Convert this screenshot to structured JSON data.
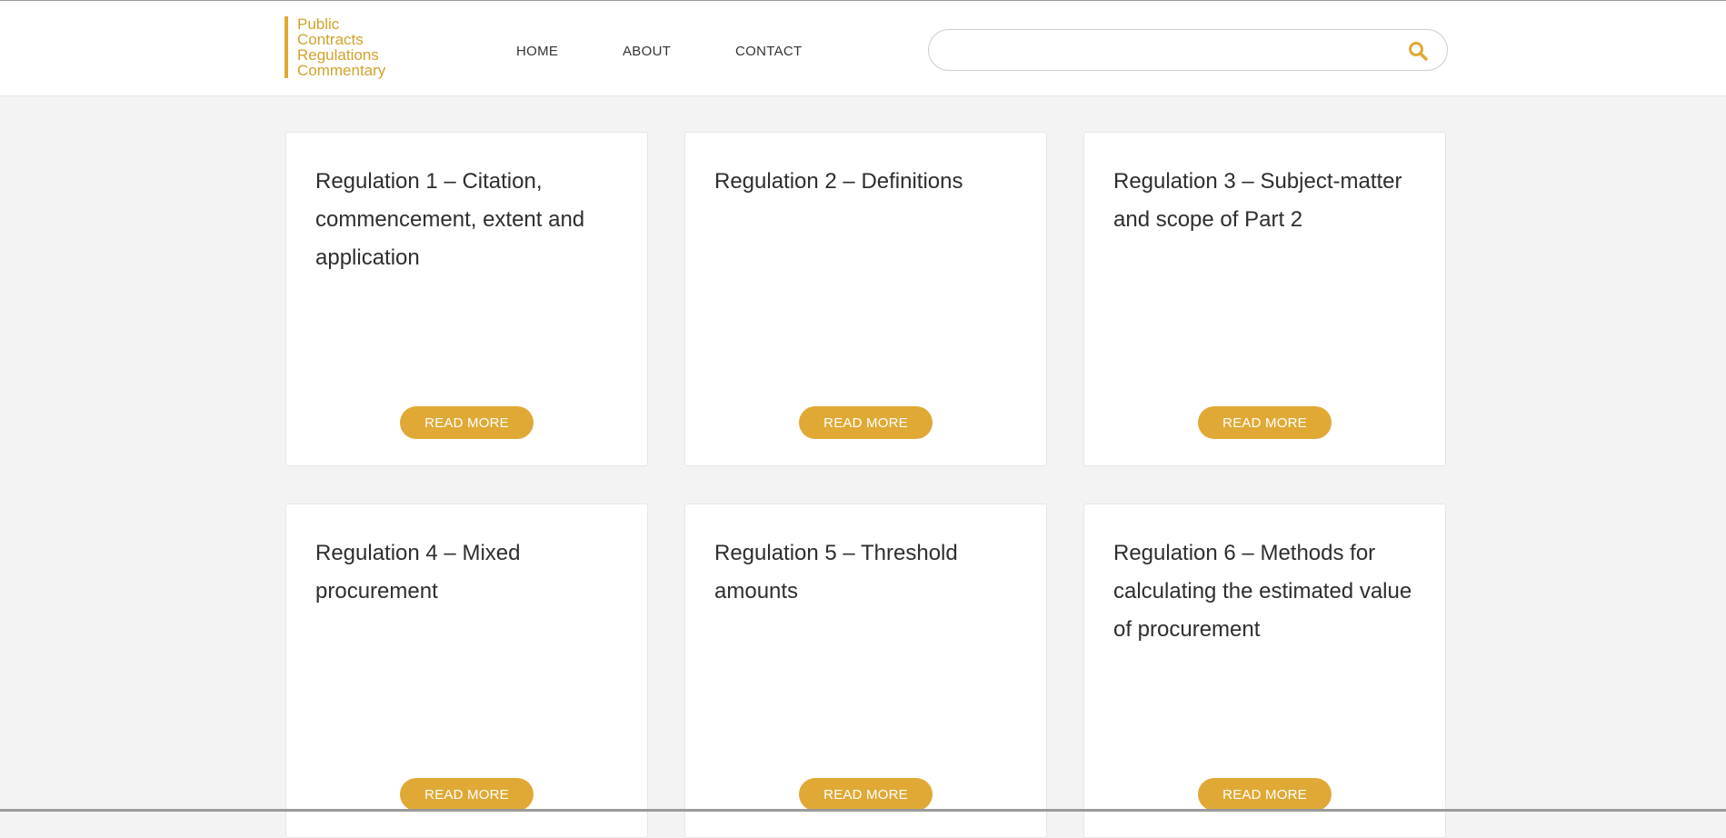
{
  "brand": {
    "lines": [
      "Public",
      "Contracts",
      "Regulations",
      "Commentary"
    ],
    "accent_color": "#e0a935"
  },
  "nav": {
    "items": [
      {
        "label": "HOME"
      },
      {
        "label": "ABOUT"
      },
      {
        "label": "CONTACT"
      }
    ]
  },
  "search": {
    "value": "",
    "placeholder": "",
    "icon": "search-icon"
  },
  "cards": [
    {
      "title": "Regulation 1 – Citation, commencement, extent and application",
      "button_label": "READ MORE"
    },
    {
      "title": "Regulation 2 – Definitions",
      "button_label": "READ MORE"
    },
    {
      "title": "Regulation 3 – Subject-matter and scope of Part 2",
      "button_label": "READ MORE"
    },
    {
      "title": "Regulation 4 – Mixed procurement",
      "button_label": "READ MORE"
    },
    {
      "title": "Regulation 5 – Threshold amounts",
      "button_label": "READ MORE"
    },
    {
      "title": "Regulation 6 – Methods for calculating the estimated value of procurement",
      "button_label": "READ MORE"
    }
  ]
}
